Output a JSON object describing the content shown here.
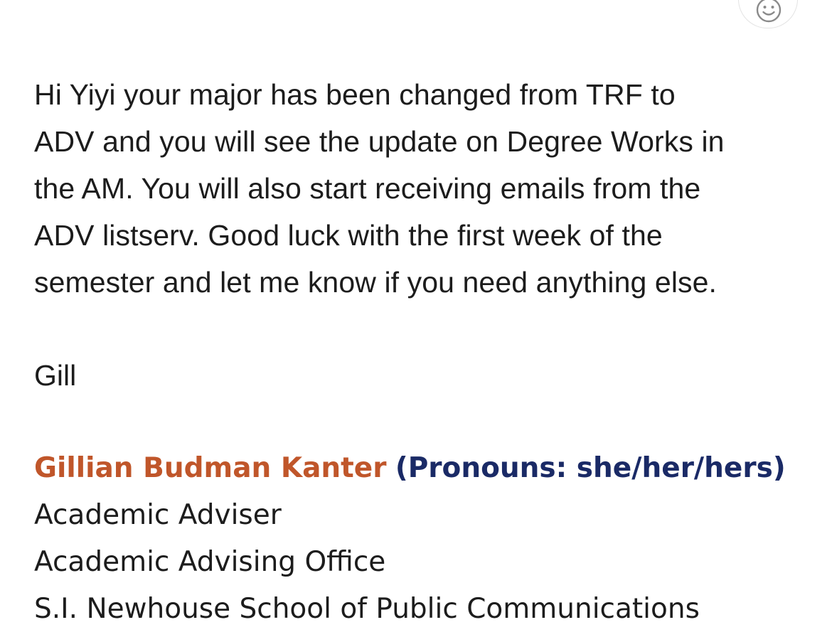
{
  "reaction": {
    "icon": "smiley-face-icon"
  },
  "message": {
    "body_lines": [
      "Hi Yiyi your major has been changed from TRF to",
      "ADV and you will see the update on Degree Works in",
      "the AM.  You will also start receiving emails from the",
      "ADV listserv.  Good luck with the first week of the",
      "semester and let me know if you need anything else."
    ],
    "signoff": "Gill"
  },
  "signature": {
    "name": "Gillian Budman Kanter",
    "pronouns": "(Pronouns: she/her/hers)",
    "title": "Academic Adviser",
    "office": "Academic Advising Office",
    "school": "S.I. Newhouse School of Public Communications",
    "colors": {
      "name": "#c0562a",
      "pronouns": "#1a2a66"
    }
  }
}
